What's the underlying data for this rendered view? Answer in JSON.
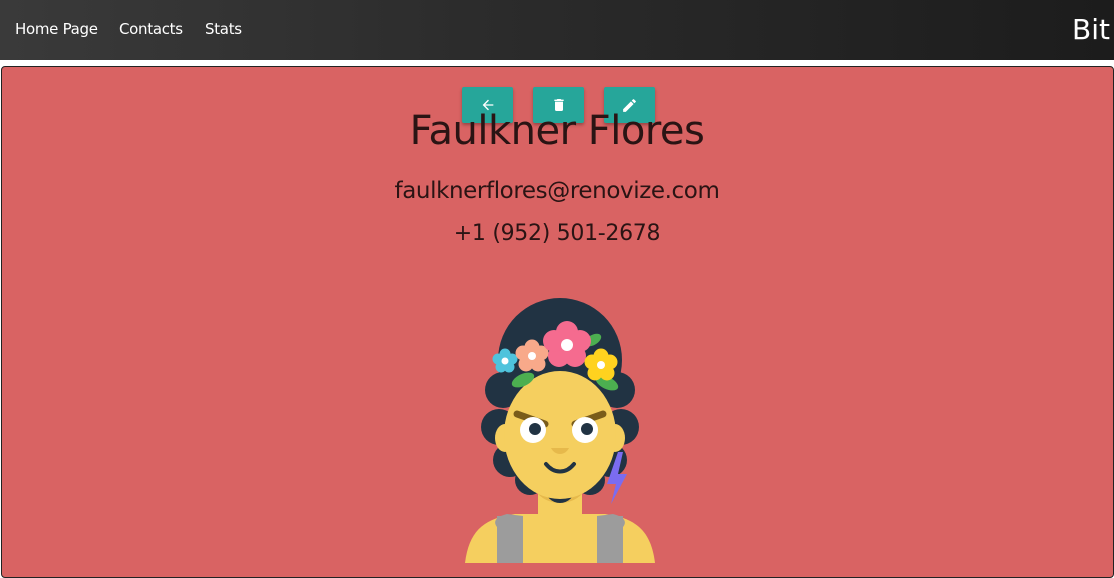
{
  "nav": {
    "links": [
      "Home Page",
      "Contacts",
      "Stats"
    ],
    "brand": "Bit"
  },
  "toolbar": {
    "back_icon": "arrow-left-icon",
    "delete_icon": "trash-icon",
    "edit_icon": "pencil-icon"
  },
  "contact": {
    "name": "Faulkner Flores",
    "email": "faulknerflores@renovize.com",
    "phone": "+1 (952) 501-2678",
    "avatar_icon": "avatar-woman-flower-crown"
  },
  "colors": {
    "card_background": "#d96363",
    "button": "#26a69a",
    "navbar": "#2b2b2b"
  }
}
